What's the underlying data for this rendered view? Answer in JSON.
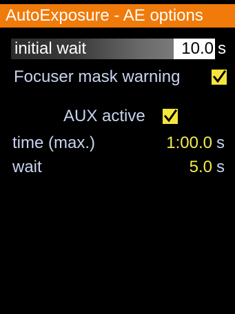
{
  "header": {
    "title": "AutoExposure - AE options",
    "color": "#f07a0a"
  },
  "initial_wait": {
    "label": "initial wait",
    "value": "10.0",
    "unit": "s"
  },
  "focuser_mask_warning": {
    "label": "Focuser mask warning",
    "checked": true
  },
  "aux": {
    "label": "AUX active",
    "checked": true
  },
  "time_max": {
    "label": "time (max.)",
    "value": "1:00.0",
    "unit": "s"
  },
  "wait": {
    "label": "wait",
    "value": "5.0",
    "unit": "s"
  },
  "colors": {
    "label_text": "#c8d4ef",
    "value_text": "#f4ec4c",
    "checkbox": "#f6e63c"
  },
  "icons": [
    "checkmark-icon"
  ]
}
